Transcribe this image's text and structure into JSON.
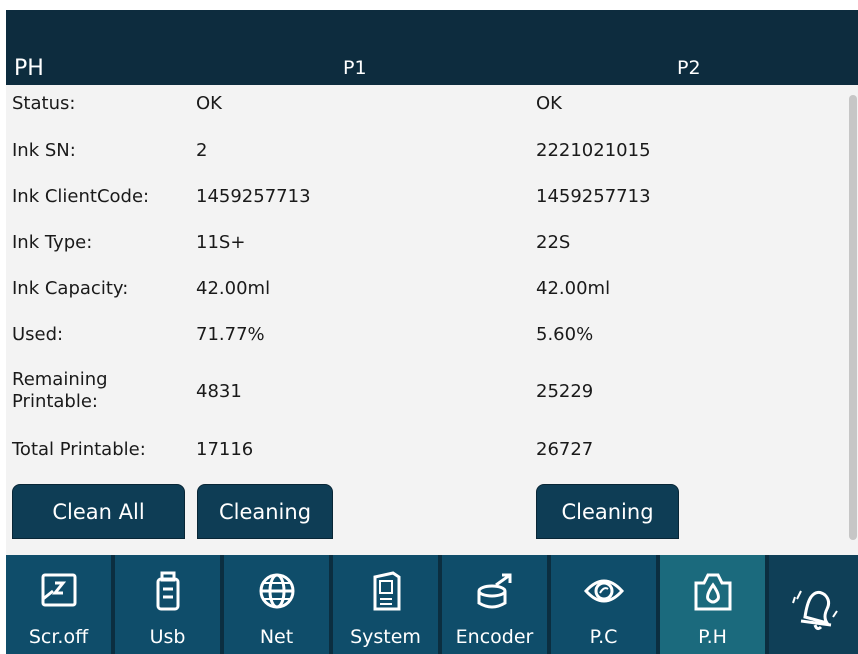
{
  "header": {
    "title": "PH",
    "col1": "P1",
    "col2": "P2"
  },
  "rows": [
    {
      "label": "Status:",
      "p1": "OK",
      "p2": "OK"
    },
    {
      "label": "Ink SN:",
      "p1": "2",
      "p2": "2221021015"
    },
    {
      "label": "Ink ClientCode:",
      "p1": "1459257713",
      "p2": "1459257713"
    },
    {
      "label": "Ink Type:",
      "p1": "11S+",
      "p2": "22S"
    },
    {
      "label": "Ink Capacity:",
      "p1": "42.00ml",
      "p2": "42.00ml"
    },
    {
      "label": "Used:",
      "p1": "71.77%",
      "p2": "5.60%"
    },
    {
      "label_line1": "Remaining",
      "label_line2": "Printable:",
      "p1": "4831",
      "p2": "25229"
    },
    {
      "label": "Total Printable:",
      "p1": "17116",
      "p2": "26727"
    }
  ],
  "buttons": {
    "clean_all": "Clean All",
    "cleaning_p1": "Cleaning",
    "cleaning_p2": "Cleaning"
  },
  "tabs": [
    {
      "label": "Scr.off",
      "icon": "screen-off-icon"
    },
    {
      "label": "Usb",
      "icon": "usb-icon"
    },
    {
      "label": "Net",
      "icon": "globe-icon"
    },
    {
      "label": "System",
      "icon": "system-icon"
    },
    {
      "label": "Encoder",
      "icon": "encoder-icon"
    },
    {
      "label": "P.C",
      "icon": "eye-icon"
    },
    {
      "label": "P.H",
      "icon": "ink-drop-icon"
    }
  ],
  "colors": {
    "header": "#0d2c3e",
    "footer": "#0b2e40",
    "tab": "#0f4d6a",
    "tab_active": "#1b6a7d",
    "button": "#0e3d55"
  }
}
